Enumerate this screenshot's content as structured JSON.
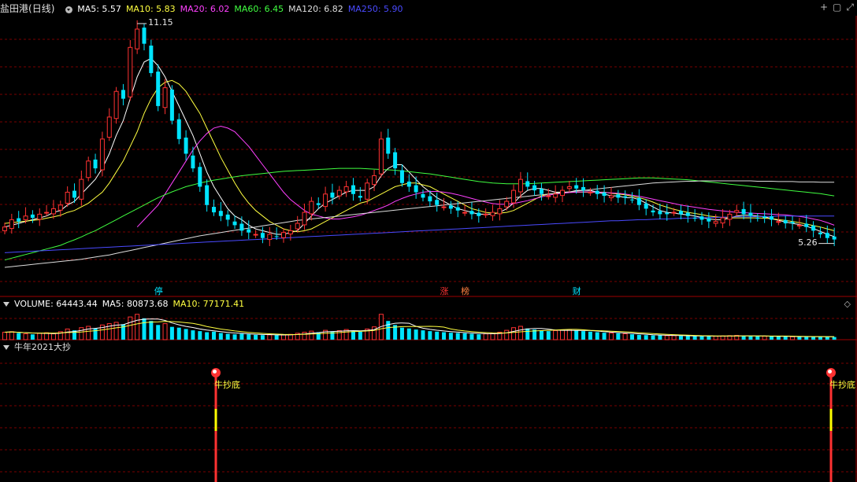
{
  "stock": {
    "name": "盐田港",
    "period": "(日线)"
  },
  "ma_header": [
    {
      "text": "MA5: 5.57",
      "color": "#ffffff"
    },
    {
      "text": "MA10: 5.83",
      "color": "#ffff40"
    },
    {
      "text": "MA20: 6.02",
      "color": "#ff40ff"
    },
    {
      "text": "MA60: 6.45",
      "color": "#40ff40"
    },
    {
      "text": "MA120: 6.82",
      "color": "#dddddd"
    },
    {
      "text": "MA250: 5.90",
      "color": "#4a4aff"
    }
  ],
  "vol_header": [
    {
      "text": "VOLUME: 64443.44",
      "color": "#ffffff"
    },
    {
      "text": "MA5: 80873.68",
      "color": "#ffffff"
    },
    {
      "text": "MA10: 77171.41",
      "color": "#ffff40"
    }
  ],
  "indicator": {
    "name": "牛年2021大抄",
    "signal_label": "牛抄底"
  },
  "icons": [
    "plus-icon",
    "box-icon",
    "expand-icon",
    "diamond-icon"
  ],
  "colors": {
    "up": "#ff3232",
    "down": "#00e4ff",
    "grid": "#7a0000",
    "border": "#a00000",
    "signal_mid": "#ffff00"
  },
  "chart_data": [
    {
      "type": "candlestick",
      "annotations": {
        "high": "11.15",
        "low": "5.26"
      },
      "events": [
        {
          "text": "停",
          "bar": 22,
          "color": "#00e4ff"
        },
        {
          "text": "涨",
          "bar": 63,
          "color": "#ff3232"
        },
        {
          "text": "榜",
          "bar": 66,
          "color": "#ff8040"
        },
        {
          "text": "财",
          "bar": 82,
          "color": "#00e4ff"
        }
      ],
      "close": [
        5.6,
        5.8,
        5.75,
        5.9,
        5.85,
        5.95,
        6.0,
        6.1,
        6.2,
        6.55,
        6.4,
        6.9,
        7.4,
        7.2,
        8.0,
        8.6,
        9.3,
        9.1,
        10.5,
        11.0,
        10.6,
        9.8,
        8.9,
        9.4,
        8.5,
        8.0,
        7.6,
        7.2,
        6.7,
        6.2,
        6.0,
        5.9,
        5.8,
        5.65,
        5.5,
        5.45,
        5.4,
        5.3,
        5.4,
        5.35,
        5.45,
        5.5,
        5.7,
        6.0,
        6.3,
        6.2,
        6.5,
        6.4,
        6.6,
        6.7,
        6.5,
        6.4,
        6.8,
        7.0,
        8.0,
        7.6,
        7.2,
        6.8,
        6.7,
        6.55,
        6.4,
        6.3,
        6.2,
        6.15,
        6.1,
        6.05,
        6.0,
        5.95,
        5.9,
        5.95,
        6.0,
        6.1,
        6.3,
        6.6,
        6.9,
        6.7,
        6.6,
        6.5,
        6.45,
        6.5,
        6.6,
        6.7,
        6.65,
        6.6,
        6.55,
        6.5,
        6.45,
        6.45,
        6.4,
        6.4,
        6.35,
        6.2,
        6.1,
        6.0,
        5.95,
        5.95,
        6.0,
        5.95,
        5.9,
        5.85,
        5.8,
        5.75,
        5.75,
        5.85,
        5.95,
        6.05,
        5.95,
        5.9,
        5.85,
        5.85,
        5.8,
        5.75,
        5.7,
        5.7,
        5.65,
        5.6,
        5.5,
        5.4,
        5.3,
        5.26
      ],
      "ma": {
        "MA5": [
          5.6,
          5.65,
          5.7,
          5.75,
          5.8,
          5.85,
          5.9,
          6.0,
          6.05,
          6.2,
          6.3,
          6.5,
          6.7,
          6.9,
          7.2,
          7.6,
          8.1,
          8.5,
          9.1,
          9.7,
          10.1,
          10.2,
          10.0,
          9.7,
          9.3,
          8.9,
          8.5,
          8.1,
          7.6,
          7.1,
          6.7,
          6.4,
          6.1,
          5.9,
          5.8,
          5.65,
          5.55,
          5.5,
          5.45,
          5.4,
          5.4,
          5.45,
          5.5,
          5.7,
          5.9,
          6.1,
          6.25,
          6.35,
          6.45,
          6.55,
          6.6,
          6.6,
          6.6,
          6.7,
          7.0,
          7.2,
          7.3,
          7.3,
          7.1,
          6.9,
          6.7,
          6.55,
          6.4,
          6.3,
          6.2,
          6.1,
          6.05,
          6.0,
          5.95,
          5.95,
          5.95,
          6.0,
          6.1,
          6.25,
          6.45,
          6.6,
          6.65,
          6.65,
          6.6,
          6.55,
          6.55,
          6.55,
          6.6,
          6.6,
          6.6,
          6.55,
          6.5,
          6.45,
          6.45,
          6.4,
          6.4,
          6.35,
          6.25,
          6.15,
          6.05,
          6.0,
          5.98,
          5.95,
          5.93,
          5.9,
          5.86,
          5.82,
          5.8,
          5.8,
          5.85,
          5.9,
          5.92,
          5.92,
          5.9,
          5.88,
          5.83,
          5.78,
          5.74,
          5.7,
          5.67,
          5.62,
          5.56,
          5.48,
          5.4,
          5.34
        ],
        "MA10": [
          5.7,
          5.72,
          5.74,
          5.76,
          5.78,
          5.8,
          5.84,
          5.88,
          5.92,
          6.0,
          6.05,
          6.15,
          6.25,
          6.4,
          6.55,
          6.8,
          7.1,
          7.4,
          7.8,
          8.2,
          8.7,
          9.1,
          9.4,
          9.55,
          9.6,
          9.5,
          9.3,
          9.0,
          8.7,
          8.3,
          7.9,
          7.5,
          7.15,
          6.8,
          6.5,
          6.25,
          6.05,
          5.9,
          5.75,
          5.65,
          5.55,
          5.5,
          5.47,
          5.5,
          5.55,
          5.65,
          5.75,
          5.85,
          5.95,
          6.05,
          6.15,
          6.25,
          6.3,
          6.4,
          6.5,
          6.6,
          6.7,
          6.75,
          6.8,
          6.8,
          6.75,
          6.7,
          6.6,
          6.5,
          6.4,
          6.3,
          6.2,
          6.1,
          6.05,
          6.0,
          5.98,
          5.98,
          6.0,
          6.05,
          6.15,
          6.25,
          6.35,
          6.45,
          6.5,
          6.52,
          6.55,
          6.55,
          6.55,
          6.55,
          6.55,
          6.55,
          6.55,
          6.52,
          6.5,
          6.48,
          6.44,
          6.4,
          6.35,
          6.28,
          6.2,
          6.14,
          6.08,
          6.04,
          6.0,
          5.97,
          5.94,
          5.9,
          5.88,
          5.86,
          5.85,
          5.85,
          5.85,
          5.85,
          5.85,
          5.84,
          5.83,
          5.8,
          5.78,
          5.75,
          5.72,
          5.68,
          5.64,
          5.6,
          5.55,
          5.5
        ],
        "MA20": [
          null,
          null,
          null,
          null,
          null,
          null,
          null,
          null,
          null,
          null,
          null,
          null,
          null,
          null,
          null,
          null,
          null,
          null,
          null,
          5.6,
          5.8,
          6.0,
          6.2,
          6.5,
          6.8,
          7.1,
          7.4,
          7.7,
          7.95,
          8.15,
          8.3,
          8.35,
          8.3,
          8.2,
          8.0,
          7.8,
          7.55,
          7.3,
          7.05,
          6.8,
          6.55,
          6.35,
          6.2,
          6.05,
          5.95,
          5.9,
          5.85,
          5.82,
          5.82,
          5.85,
          5.88,
          5.92,
          5.98,
          6.05,
          6.12,
          6.2,
          6.3,
          6.38,
          6.45,
          6.5,
          6.55,
          6.57,
          6.57,
          6.55,
          6.52,
          6.48,
          6.43,
          6.38,
          6.33,
          6.28,
          6.24,
          6.22,
          6.22,
          6.24,
          6.28,
          6.32,
          6.37,
          6.42,
          6.47,
          6.5,
          6.52,
          6.54,
          6.55,
          6.56,
          6.56,
          6.55,
          6.54,
          6.53,
          6.52,
          6.5,
          6.47,
          6.44,
          6.4,
          6.36,
          6.32,
          6.28,
          6.24,
          6.2,
          6.17,
          6.14,
          6.11,
          6.08,
          6.06,
          6.04,
          6.02,
          6.0,
          5.99,
          5.98,
          5.97,
          5.96,
          5.95,
          5.94,
          5.93,
          5.91,
          5.89,
          5.86,
          5.82,
          5.78,
          5.72,
          5.65
        ],
        "MA60": [
          4.7,
          4.75,
          4.8,
          4.85,
          4.9,
          4.95,
          5.0,
          5.05,
          5.1,
          5.18,
          5.25,
          5.33,
          5.42,
          5.5,
          5.6,
          5.7,
          5.8,
          5.9,
          6.0,
          6.1,
          6.2,
          6.3,
          6.4,
          6.48,
          6.56,
          6.63,
          6.7,
          6.75,
          6.8,
          6.84,
          6.88,
          6.91,
          6.94,
          6.97,
          7.0,
          7.02,
          7.04,
          7.06,
          7.08,
          7.1,
          7.12,
          7.13,
          7.14,
          7.15,
          7.16,
          7.17,
          7.18,
          7.19,
          7.2,
          7.2,
          7.2,
          7.2,
          7.19,
          7.18,
          7.17,
          7.16,
          7.15,
          7.13,
          7.11,
          7.09,
          7.07,
          7.05,
          7.02,
          6.99,
          6.96,
          6.93,
          6.9,
          6.87,
          6.84,
          6.82,
          6.8,
          6.79,
          6.78,
          6.78,
          6.78,
          6.78,
          6.79,
          6.8,
          6.81,
          6.82,
          6.83,
          6.84,
          6.85,
          6.86,
          6.87,
          6.88,
          6.89,
          6.9,
          6.91,
          6.92,
          6.93,
          6.94,
          6.94,
          6.94,
          6.93,
          6.92,
          6.91,
          6.9,
          6.89,
          6.87,
          6.85,
          6.83,
          6.81,
          6.79,
          6.77,
          6.75,
          6.73,
          6.71,
          6.69,
          6.67,
          6.65,
          6.63,
          6.61,
          6.59,
          6.57,
          6.55,
          6.53,
          6.51,
          6.48,
          6.45
        ],
        "MA120": [
          4.5,
          4.52,
          4.54,
          4.56,
          4.58,
          4.6,
          4.62,
          4.64,
          4.66,
          4.68,
          4.7,
          4.72,
          4.75,
          4.78,
          4.81,
          4.84,
          4.88,
          4.92,
          4.96,
          5.0,
          5.04,
          5.08,
          5.12,
          5.16,
          5.2,
          5.24,
          5.28,
          5.32,
          5.36,
          5.39,
          5.42,
          5.45,
          5.48,
          5.51,
          5.54,
          5.57,
          5.6,
          5.63,
          5.66,
          5.69,
          5.72,
          5.75,
          5.78,
          5.8,
          5.82,
          5.84,
          5.86,
          5.88,
          5.9,
          5.92,
          5.94,
          5.96,
          5.98,
          6.0,
          6.02,
          6.04,
          6.06,
          6.08,
          6.1,
          6.12,
          6.14,
          6.16,
          6.18,
          6.2,
          6.22,
          6.24,
          6.26,
          6.28,
          6.3,
          6.32,
          6.34,
          6.36,
          6.38,
          6.4,
          6.42,
          6.44,
          6.46,
          6.48,
          6.5,
          6.52,
          6.54,
          6.56,
          6.58,
          6.6,
          6.62,
          6.64,
          6.66,
          6.68,
          6.7,
          6.72,
          6.74,
          6.76,
          6.78,
          6.8,
          6.81,
          6.82,
          6.83,
          6.84,
          6.85,
          6.85,
          6.86,
          6.86,
          6.86,
          6.86,
          6.86,
          6.86,
          6.86,
          6.86,
          6.85,
          6.85,
          6.85,
          6.84,
          6.84,
          6.84,
          6.83,
          6.83,
          6.83,
          6.82,
          6.82,
          6.82
        ],
        "MA250": [
          4.9,
          4.91,
          4.92,
          4.93,
          4.94,
          4.95,
          4.96,
          4.97,
          4.98,
          4.99,
          5.0,
          5.01,
          5.02,
          5.03,
          5.04,
          5.05,
          5.06,
          5.07,
          5.08,
          5.09,
          5.1,
          5.11,
          5.12,
          5.13,
          5.14,
          5.15,
          5.16,
          5.17,
          5.18,
          5.19,
          5.2,
          5.21,
          5.22,
          5.23,
          5.24,
          5.25,
          5.26,
          5.27,
          5.28,
          5.29,
          5.3,
          5.31,
          5.32,
          5.33,
          5.34,
          5.35,
          5.36,
          5.37,
          5.38,
          5.39,
          5.4,
          5.41,
          5.42,
          5.43,
          5.44,
          5.45,
          5.46,
          5.47,
          5.48,
          5.49,
          5.5,
          5.51,
          5.52,
          5.53,
          5.54,
          5.55,
          5.56,
          5.57,
          5.58,
          5.59,
          5.6,
          5.61,
          5.62,
          5.63,
          5.64,
          5.65,
          5.66,
          5.67,
          5.68,
          5.69,
          5.7,
          5.71,
          5.72,
          5.73,
          5.74,
          5.75,
          5.76,
          5.77,
          5.77,
          5.78,
          5.79,
          5.8,
          5.8,
          5.81,
          5.82,
          5.82,
          5.83,
          5.84,
          5.84,
          5.85,
          5.85,
          5.86,
          5.86,
          5.87,
          5.87,
          5.88,
          5.88,
          5.88,
          5.89,
          5.89,
          5.89,
          5.9,
          5.9,
          5.9,
          5.9,
          5.9,
          5.9,
          5.9,
          5.9,
          5.9
        ]
      }
    },
    {
      "type": "bar",
      "volume": [
        28,
        30,
        25,
        22,
        20,
        24,
        26,
        22,
        30,
        40,
        35,
        45,
        50,
        42,
        55,
        60,
        65,
        58,
        85,
        95,
        80,
        70,
        55,
        60,
        48,
        45,
        40,
        35,
        32,
        28,
        30,
        25,
        22,
        20,
        22,
        20,
        18,
        17,
        18,
        17,
        18,
        20,
        24,
        28,
        32,
        28,
        35,
        30,
        34,
        38,
        32,
        30,
        40,
        48,
        95,
        70,
        55,
        45,
        42,
        38,
        35,
        32,
        30,
        28,
        26,
        25,
        24,
        22,
        20,
        22,
        24,
        28,
        35,
        45,
        50,
        42,
        38,
        35,
        32,
        34,
        36,
        38,
        34,
        32,
        30,
        28,
        26,
        25,
        24,
        22,
        20,
        18,
        17,
        16,
        16,
        15,
        15,
        14,
        14,
        13,
        13,
        13,
        13,
        14,
        15,
        16,
        14,
        13,
        13,
        13,
        12,
        12,
        12,
        11,
        11,
        11,
        11,
        11,
        11,
        10
      ]
    }
  ]
}
